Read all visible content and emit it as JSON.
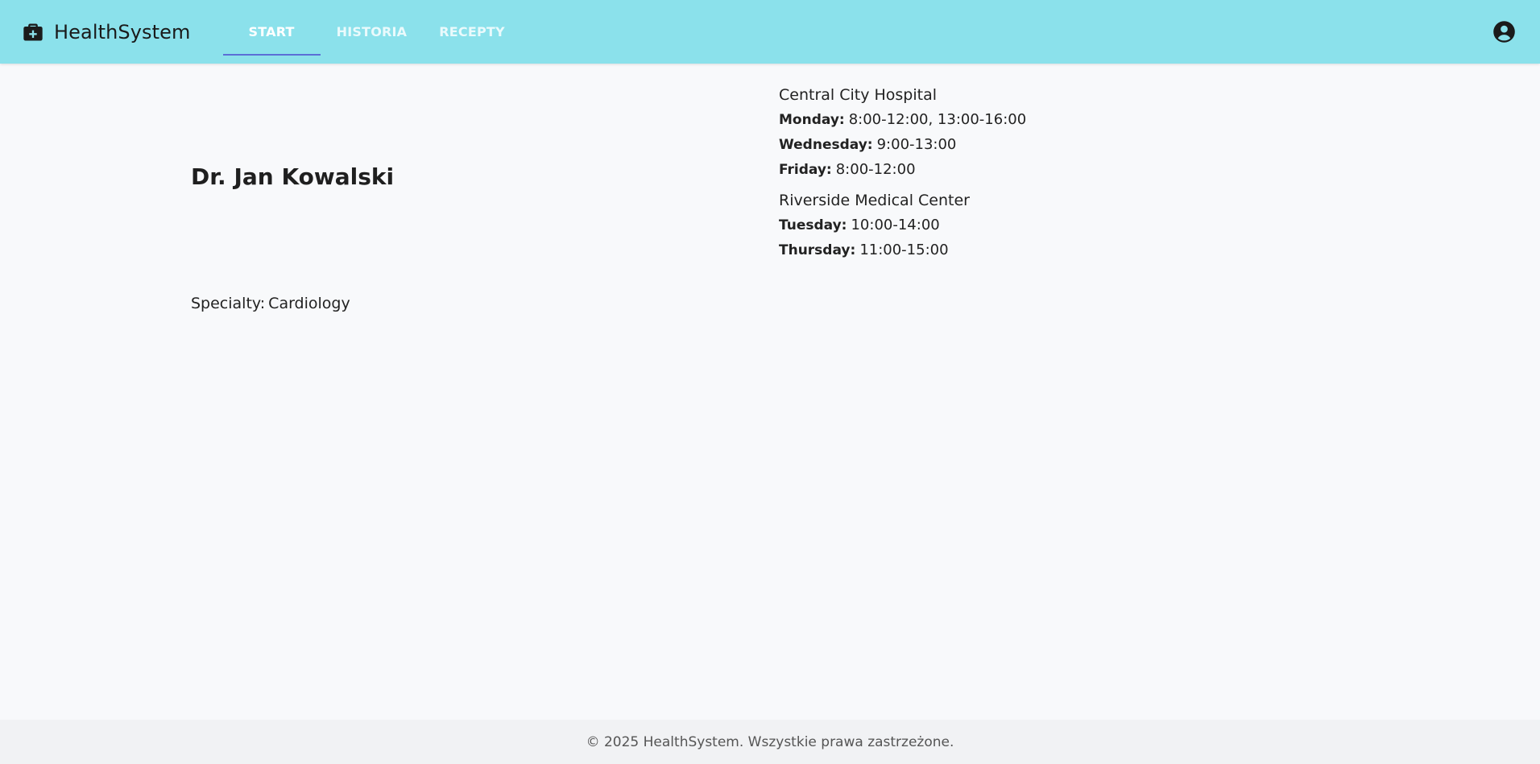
{
  "app": {
    "name": "HealthSystem"
  },
  "nav": {
    "tabs": [
      {
        "label": "START",
        "active": true
      },
      {
        "label": "HISTORIA",
        "active": false
      },
      {
        "label": "RECEPTY",
        "active": false
      }
    ]
  },
  "icons": {
    "brand": "medical-kit-icon",
    "account": "account-circle-icon"
  },
  "doctor": {
    "name": "Dr. Jan Kowalski",
    "specialty_label": "Specialty:",
    "specialty_value": "Cardiology"
  },
  "locations": [
    {
      "name": "Central City Hospital",
      "hours": [
        {
          "day": "Monday:",
          "time": "8:00-12:00, 13:00-16:00"
        },
        {
          "day": "Wednesday:",
          "time": "9:00-13:00"
        },
        {
          "day": "Friday:",
          "time": "8:00-12:00"
        }
      ]
    },
    {
      "name": "Riverside Medical Center",
      "hours": [
        {
          "day": "Tuesday:",
          "time": "10:00-14:00"
        },
        {
          "day": "Thursday:",
          "time": "11:00-15:00"
        }
      ]
    }
  ],
  "footer": {
    "text": "© 2025 HealthSystem. Wszystkie prawa zastrzeżone."
  },
  "colors": {
    "header_bg": "#8be1eb",
    "tab_indicator": "#5b6ed6",
    "page_bg": "#f8f9fb",
    "footer_bg": "#f1f2f4"
  }
}
